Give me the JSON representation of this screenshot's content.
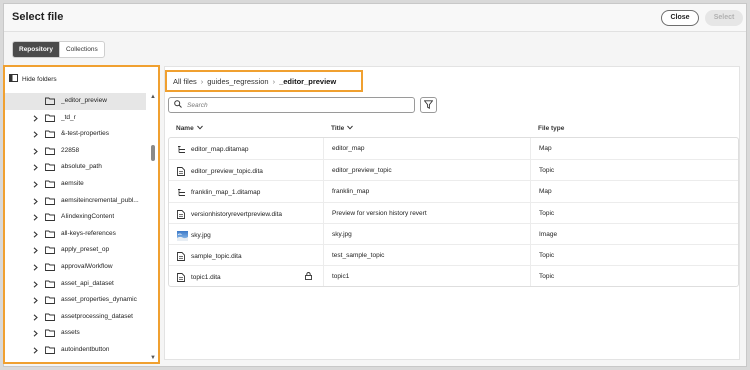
{
  "dialog": {
    "title": "Select file",
    "close_label": "Close",
    "select_label": "Select"
  },
  "tabs": [
    {
      "label": "Repository",
      "active": true
    },
    {
      "label": "Collections",
      "active": false
    }
  ],
  "sidebar": {
    "hide_folders_label": "Hide folders",
    "items": [
      {
        "label": "_editor_preview",
        "selected": true,
        "expandable": false
      },
      {
        "label": "_td_r",
        "selected": false,
        "expandable": true
      },
      {
        "label": "&-test-properties",
        "selected": false,
        "expandable": true
      },
      {
        "label": "22858",
        "selected": false,
        "expandable": true
      },
      {
        "label": "absolute_path",
        "selected": false,
        "expandable": true
      },
      {
        "label": "aemsite",
        "selected": false,
        "expandable": true
      },
      {
        "label": "aemsiteincremental_publ...",
        "selected": false,
        "expandable": true
      },
      {
        "label": "AIindexingContent",
        "selected": false,
        "expandable": true
      },
      {
        "label": "all-keys-references",
        "selected": false,
        "expandable": true
      },
      {
        "label": "apply_preset_op",
        "selected": false,
        "expandable": true
      },
      {
        "label": "approvalWorkflow",
        "selected": false,
        "expandable": true
      },
      {
        "label": "asset_api_dataset",
        "selected": false,
        "expandable": true
      },
      {
        "label": "asset_properties_dynamic",
        "selected": false,
        "expandable": true
      },
      {
        "label": "assetprocessing_dataset",
        "selected": false,
        "expandable": true
      },
      {
        "label": "assets",
        "selected": false,
        "expandable": true
      },
      {
        "label": "autoindentbutton",
        "selected": false,
        "expandable": true
      }
    ]
  },
  "breadcrumb": {
    "items": [
      "All files",
      "guides_regression"
    ],
    "current": "_editor_preview"
  },
  "search": {
    "placeholder": "Search"
  },
  "table": {
    "columns": {
      "name": "Name",
      "title": "Title",
      "file_type": "File type"
    },
    "rows": [
      {
        "name": "editor_map.ditamap",
        "title": "editor_map",
        "type": "Map",
        "icon": "ditamap-icon",
        "locked": false
      },
      {
        "name": "editor_preview_topic.dita",
        "title": "editor_preview_topic",
        "type": "Topic",
        "icon": "dita-file-icon",
        "locked": false
      },
      {
        "name": "franklin_map_1.ditamap",
        "title": "franklin_map",
        "type": "Map",
        "icon": "ditamap-icon",
        "locked": false
      },
      {
        "name": "versionhistoryrevertpreview.dita",
        "title": "Preview for version history revert",
        "type": "Topic",
        "icon": "dita-file-icon",
        "locked": false
      },
      {
        "name": "sky.jpg",
        "title": "sky.jpg",
        "type": "Image",
        "icon": "image-thumbnail",
        "locked": false
      },
      {
        "name": "sample_topic.dita",
        "title": "test_sample_topic",
        "type": "Topic",
        "icon": "dita-file-icon",
        "locked": false
      },
      {
        "name": "topic1.dita",
        "title": "topic1",
        "type": "Topic",
        "icon": "dita-file-icon",
        "locked": true
      }
    ]
  },
  "colors": {
    "highlight_border": "#f0a030",
    "active_tab": "#4b4b4b",
    "selected_row": "#e6e6e6"
  }
}
